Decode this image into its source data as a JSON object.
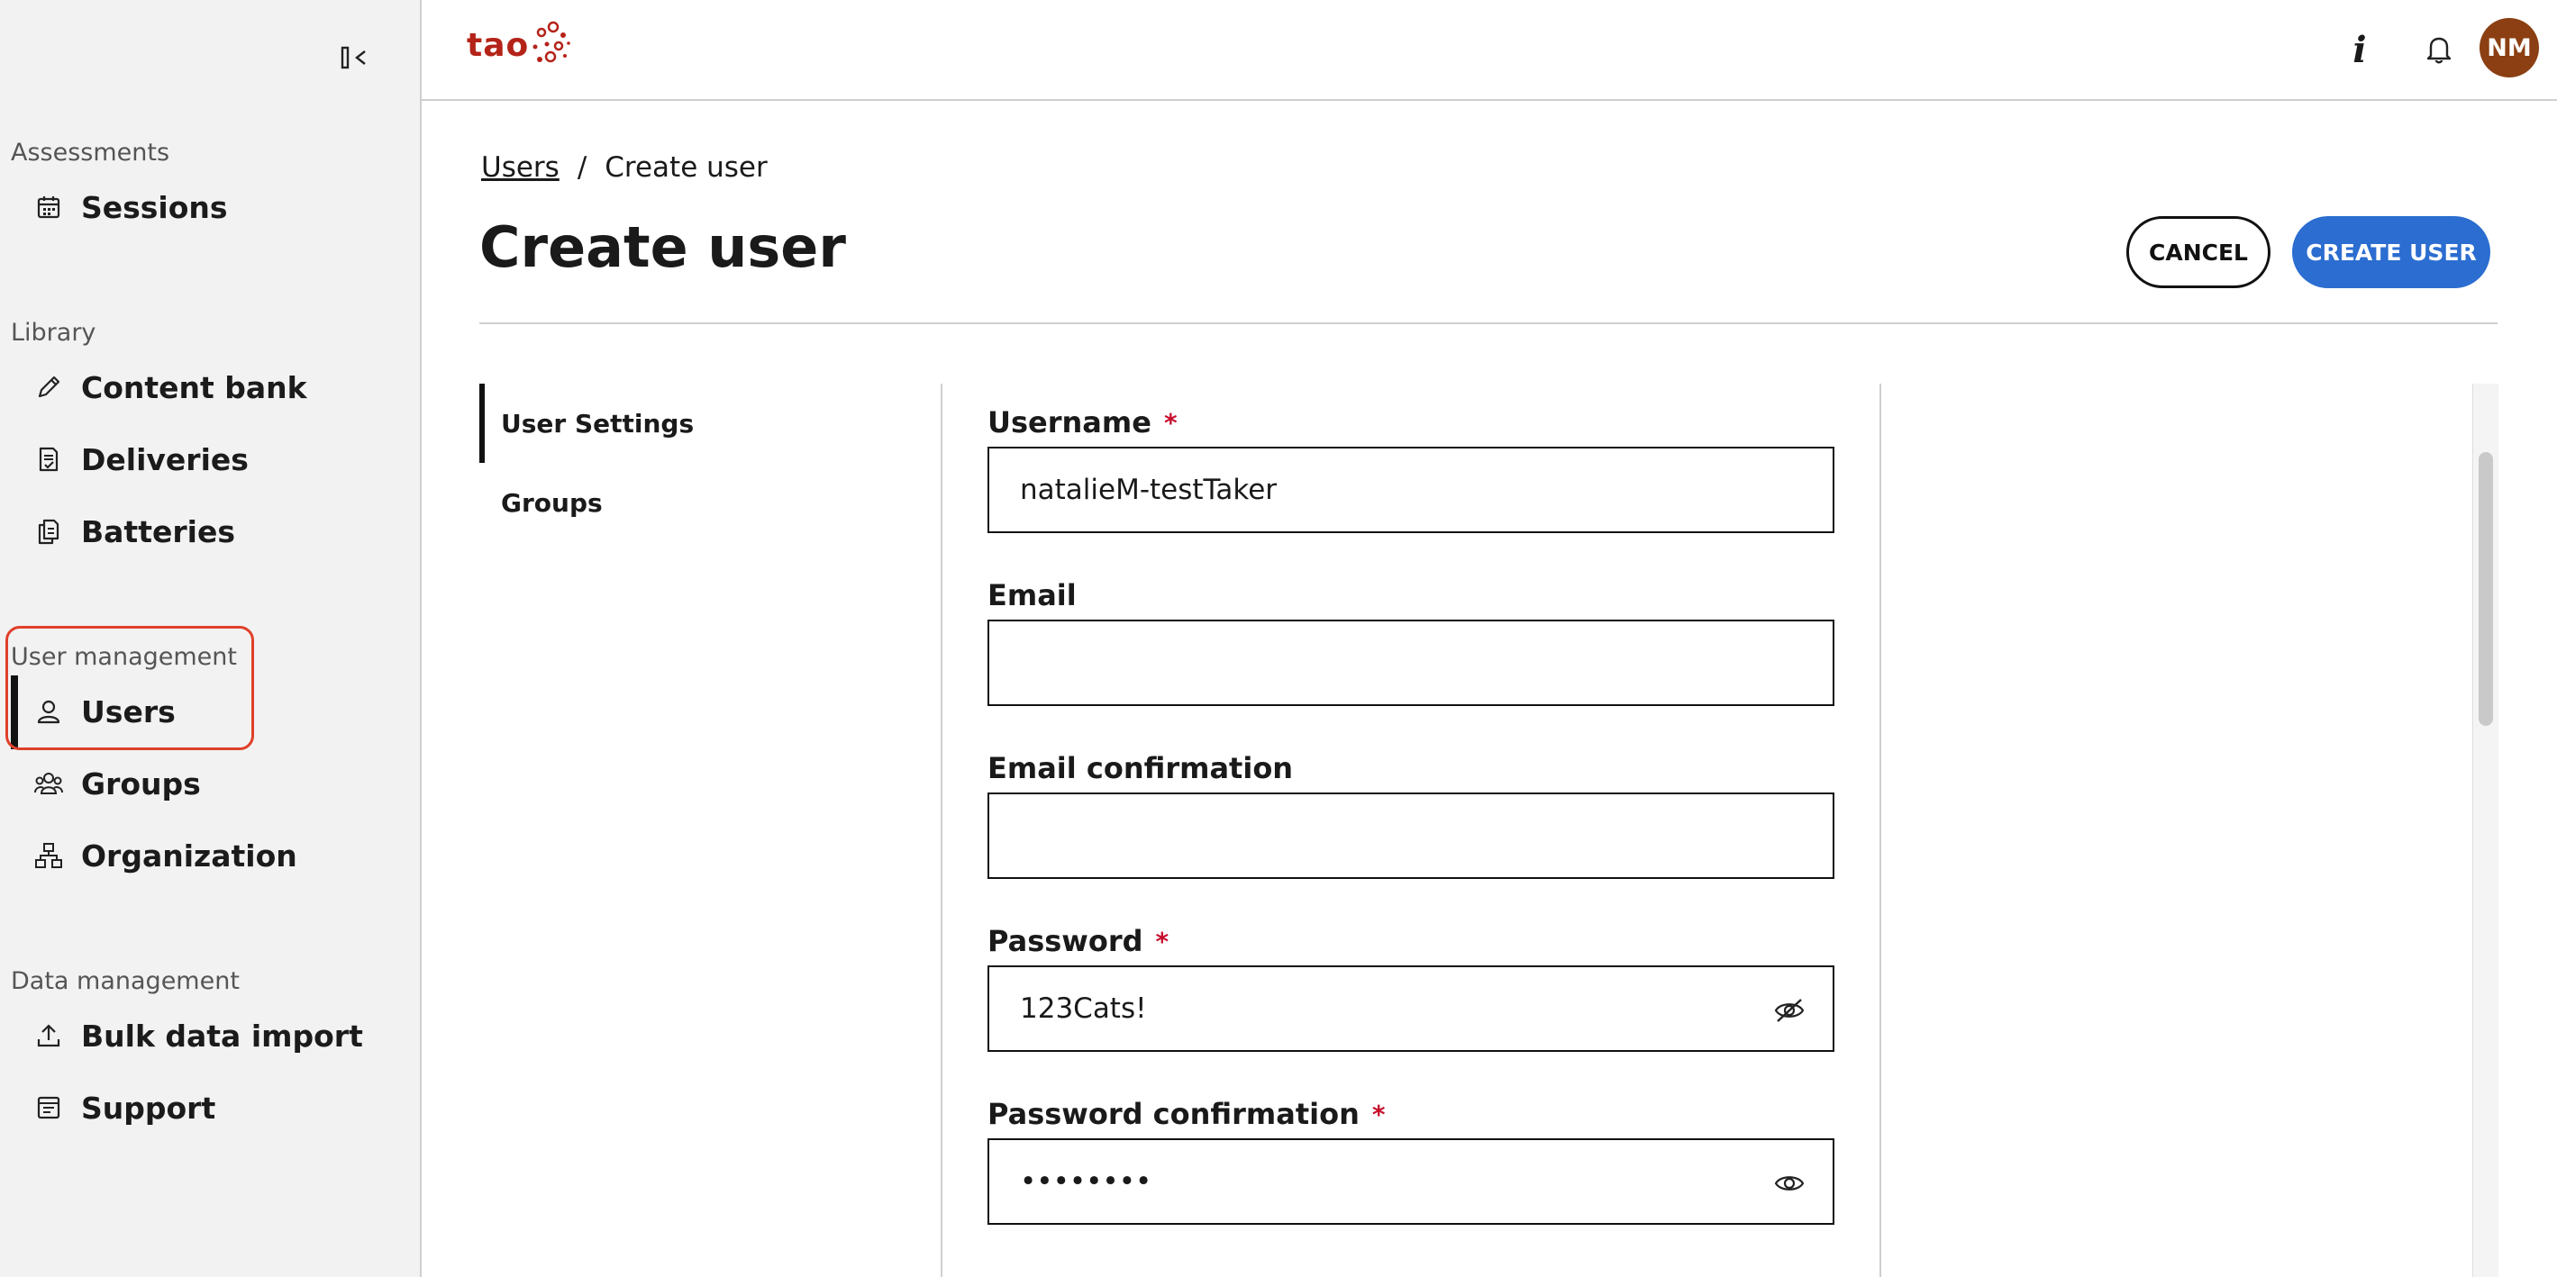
{
  "header": {
    "logo_text": "tao",
    "avatar_initials": "NM"
  },
  "sidebar": {
    "sections": [
      {
        "label": "Assessments",
        "items": [
          {
            "label": "Sessions",
            "icon": "calendar-icon"
          }
        ]
      },
      {
        "label": "Library",
        "items": [
          {
            "label": "Content bank",
            "icon": "pencil-icon"
          },
          {
            "label": "Deliveries",
            "icon": "document-check-icon"
          },
          {
            "label": "Batteries",
            "icon": "documents-icon"
          }
        ]
      },
      {
        "label": "User management",
        "items": [
          {
            "label": "Users",
            "icon": "user-icon",
            "active": true
          },
          {
            "label": "Groups",
            "icon": "users-group-icon"
          },
          {
            "label": "Organization",
            "icon": "org-chart-icon"
          }
        ]
      },
      {
        "label": "Data management",
        "items": [
          {
            "label": "Bulk data import",
            "icon": "upload-icon"
          },
          {
            "label": "Support",
            "icon": "support-icon"
          }
        ]
      }
    ]
  },
  "breadcrumb": {
    "parent": "Users",
    "separator": "/",
    "current": "Create user"
  },
  "page": {
    "title": "Create user"
  },
  "actions": {
    "cancel_label": "CANCEL",
    "create_label": "CREATE USER"
  },
  "subnav": {
    "items": [
      "User Settings",
      "Groups"
    ]
  },
  "form": {
    "username": {
      "label": "Username",
      "required_mark": "*",
      "value": "natalieM-testTaker"
    },
    "email": {
      "label": "Email",
      "value": ""
    },
    "email_confirmation": {
      "label": "Email confirmation",
      "value": ""
    },
    "password": {
      "label": "Password",
      "required_mark": "*",
      "value": "123Cats!"
    },
    "password_confirmation": {
      "label": "Password confirmation",
      "required_mark": "*",
      "value": "12345678"
    }
  },
  "colors": {
    "accent": "#2b6dd0",
    "avatar": "#8b3f12",
    "required": "#c8102e",
    "highlight": "#e0402a",
    "brand": "#b42318"
  }
}
